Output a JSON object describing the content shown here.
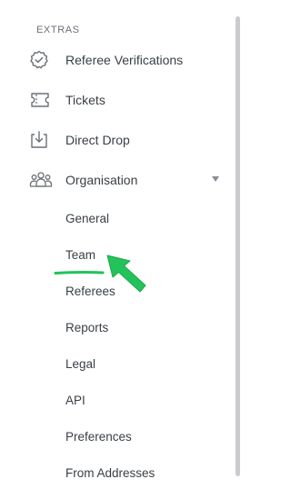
{
  "extras": {
    "heading": "EXTRAS",
    "items": [
      {
        "label": "Referee Verifications",
        "icon": "badge-check-icon"
      },
      {
        "label": "Tickets",
        "icon": "ticket-icon"
      },
      {
        "label": "Direct Drop",
        "icon": "download-tray-icon"
      },
      {
        "label": "Organisation",
        "icon": "people-group-icon",
        "expanded": true
      }
    ],
    "organisation_submenu": [
      {
        "label": "General"
      },
      {
        "label": "Team",
        "highlighted": true
      },
      {
        "label": "Referees"
      },
      {
        "label": "Reports"
      },
      {
        "label": "Legal"
      },
      {
        "label": "API"
      },
      {
        "label": "Preferences"
      },
      {
        "label": "From Addresses"
      }
    ]
  },
  "colors": {
    "text": "#3a3f45",
    "icon": "#6b7076",
    "annotation": "#22c35a",
    "scrollbar": "#c9cbce"
  }
}
